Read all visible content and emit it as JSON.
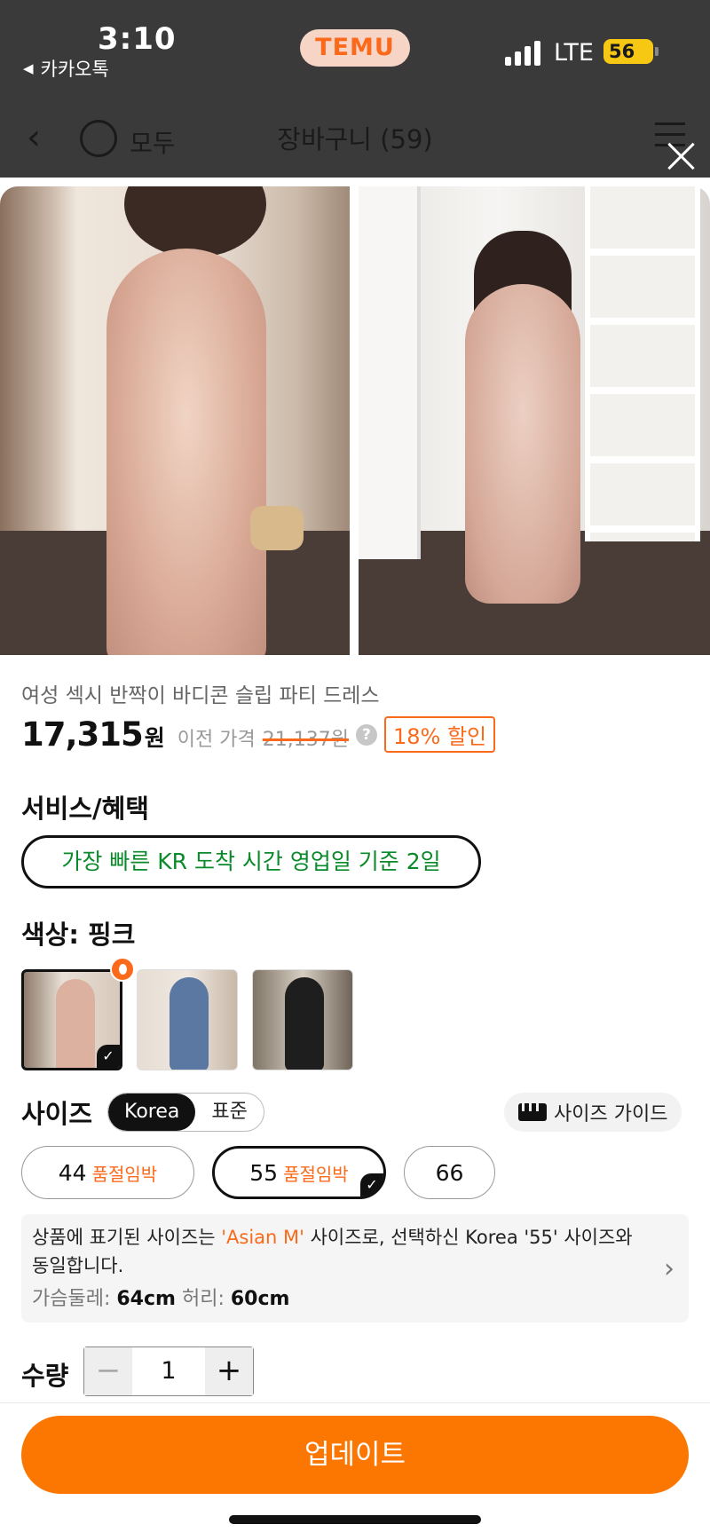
{
  "status_bar": {
    "time": "3:10",
    "back_app": "카카오톡",
    "back_glyph": "◀",
    "app_badge": "TEMU",
    "network": "LTE",
    "battery": "56"
  },
  "cart_header": {
    "select_all": "모두",
    "title": "장바구니 (59)"
  },
  "product": {
    "title": "여성 섹시 반짝이 바디콘 슬립 파티 드레스",
    "price": "17,315",
    "price_unit": "원",
    "prev_price_label": "이전 가격",
    "prev_price": "21,137원",
    "help_glyph": "?",
    "discount": "18% 할인"
  },
  "service": {
    "title": "서비스/혜택",
    "delivery": "가장 빠른 KR 도착 시간 영업일 기준 2일"
  },
  "color": {
    "title": "색상: 핑크",
    "swatches": [
      "핑크",
      "블루",
      "블랙"
    ],
    "selected_index": 0
  },
  "size": {
    "title": "사이즈",
    "systems": [
      "Korea",
      "표준"
    ],
    "active_system": "Korea",
    "guide_label": "사이즈 가이드",
    "options": [
      {
        "label": "44",
        "note": "품절임박"
      },
      {
        "label": "55",
        "note": "품절임박"
      },
      {
        "label": "66",
        "note": ""
      }
    ],
    "selected": "55",
    "info_pre": "상품에 표기된 사이즈는 ",
    "info_highlight": "'Asian M'",
    "info_post": " 사이즈로, 선택하신 Korea '55' 사이즈와 동일합니다.",
    "chest_label": "가슴둘레:",
    "chest_value": "64cm",
    "waist_label": "허리:",
    "waist_value": "60cm"
  },
  "quantity": {
    "title": "수량",
    "value": "1",
    "minus": "−",
    "plus": "+"
  },
  "actions": {
    "update": "업데이트"
  },
  "colors": {
    "accent": "#fb7701",
    "discount": "#fb6a1b",
    "delivery_green": "#0a8a2a"
  }
}
